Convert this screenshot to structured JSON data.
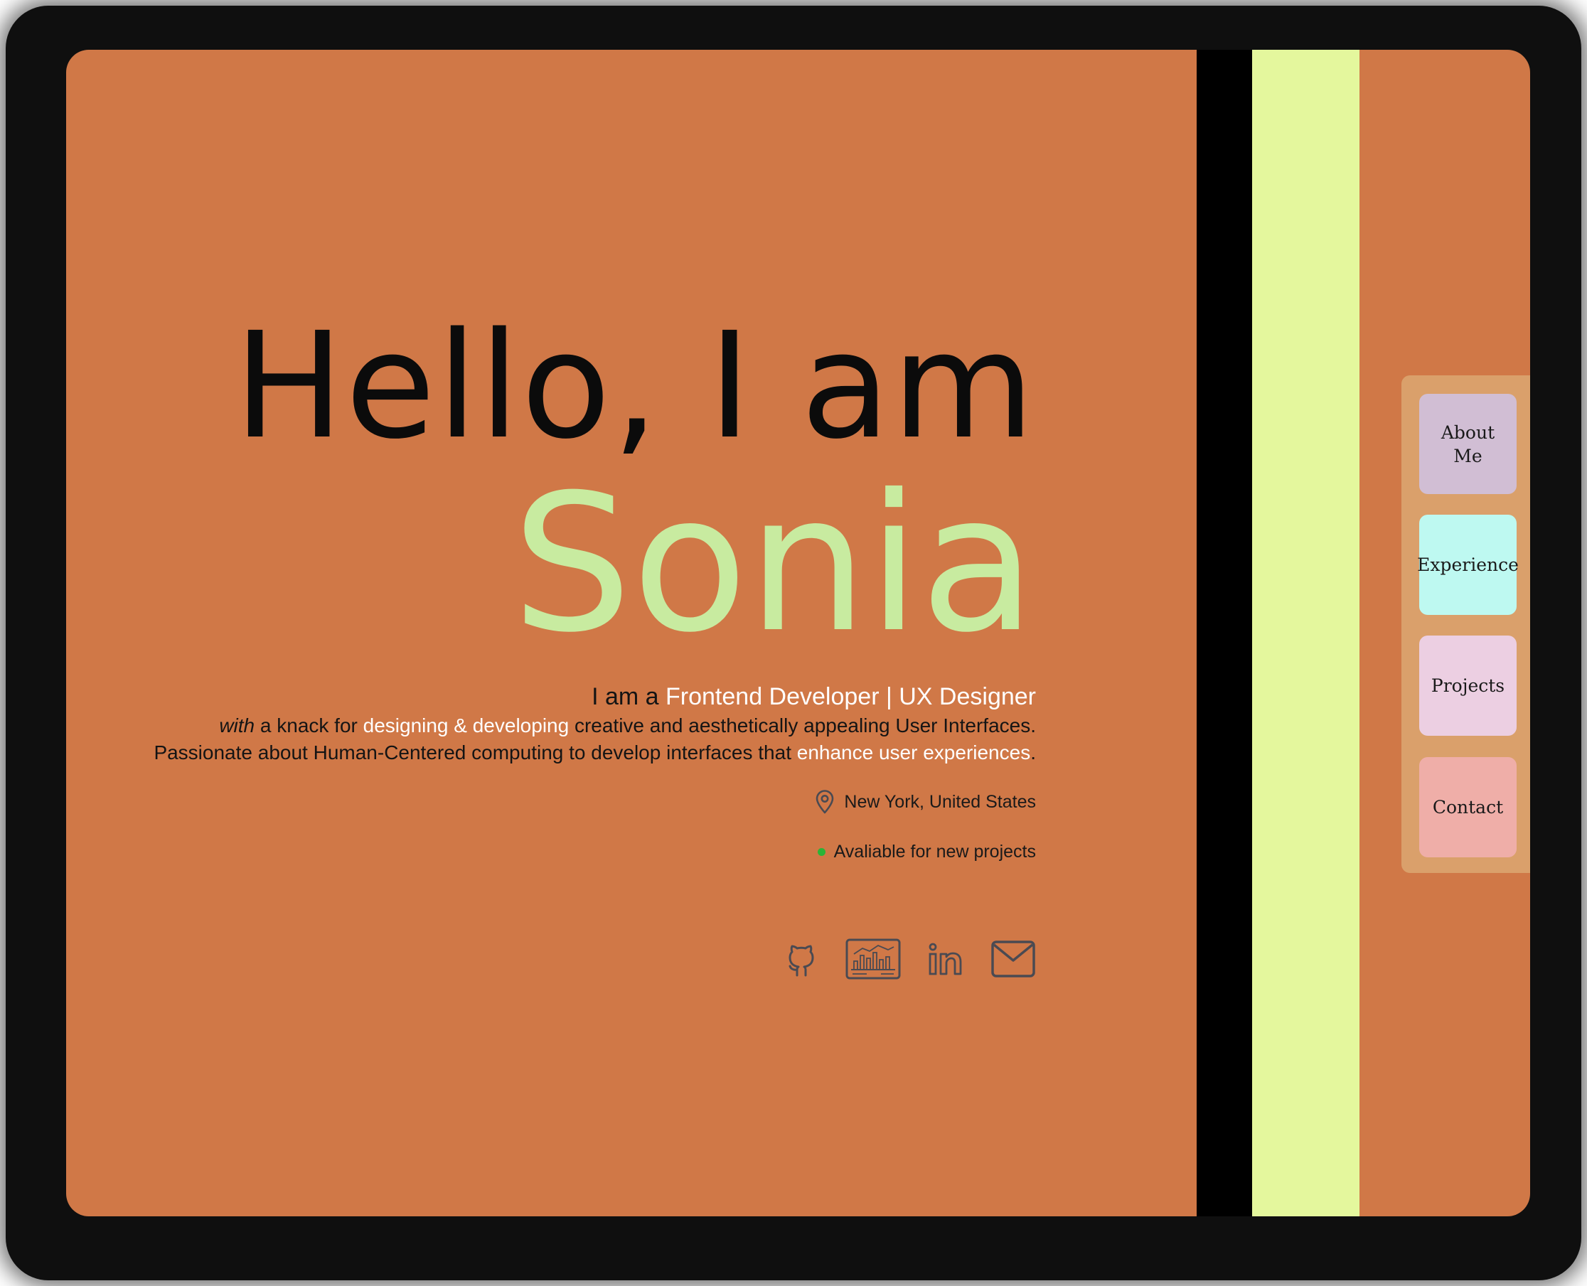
{
  "hero": {
    "greeting": "Hello, I am",
    "name": "Sonia",
    "role_prefix": "I am a ",
    "role": "Frontend Developer | UX Designer",
    "line1_italic": "with",
    "line1_a": " a knack for ",
    "line1_highlight": "designing & developing",
    "line1_b": " creative and aesthetically appealing User Interfaces.",
    "line2_a": "Passionate about Human-Centered computing to develop interfaces that ",
    "line2_highlight": "enhance user experiences",
    "line2_b": ".",
    "location": "New York, United States",
    "status": "Avaliable for new projects"
  },
  "socials": [
    {
      "icon": "github-icon"
    },
    {
      "icon": "dashboard-icon"
    },
    {
      "icon": "linkedin-icon"
    },
    {
      "icon": "mail-icon"
    }
  ],
  "nav": {
    "about": "About Me",
    "experience": "Experience",
    "projects": "Projects",
    "contact": "Contact"
  },
  "colors": {
    "background": "#d07847",
    "name": "#c8eba0",
    "highlight": "#ffffff",
    "stripe_black": "#000000",
    "stripe_lime": "#e4f79d",
    "nav_panel": "#daa06b",
    "about_button": "#d1bed4",
    "experience_button": "#bef9f1",
    "projects_button": "#eccfe2",
    "contact_button": "#efaea8",
    "status_dot": "#2bb437"
  }
}
